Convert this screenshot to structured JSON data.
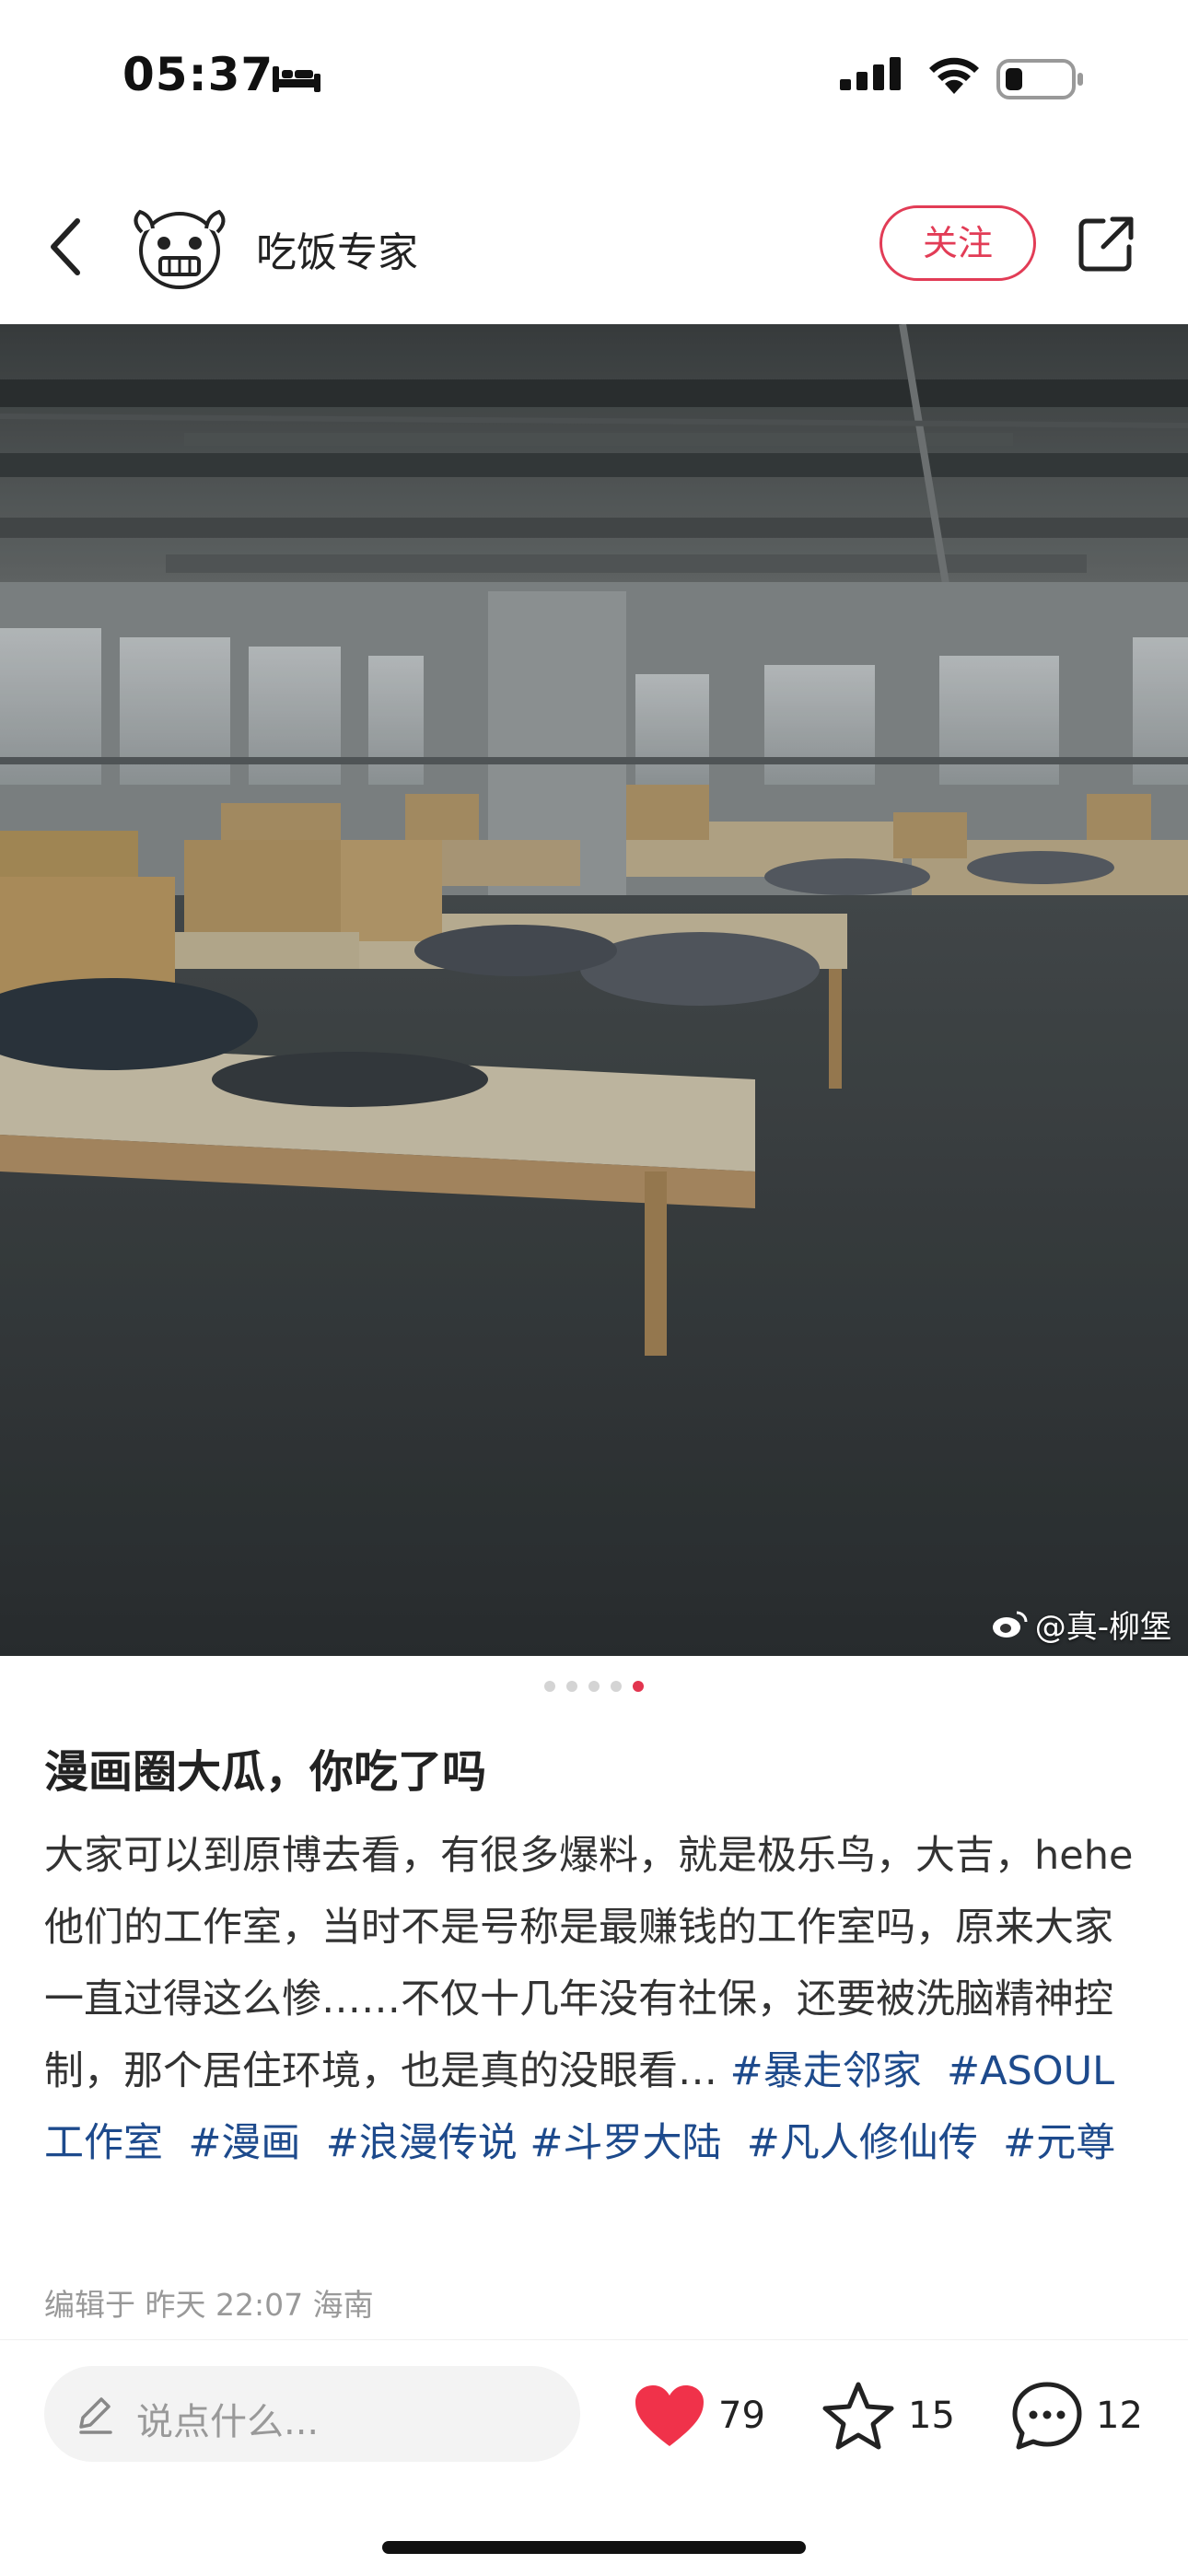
{
  "status_bar": {
    "time": "05:37"
  },
  "header": {
    "author_name": "吃饭专家",
    "follow_label": "关注"
  },
  "photo": {
    "watermark": "@真-柳堡",
    "page_count": 5,
    "active_page": 5
  },
  "post": {
    "title": "漫画圈大瓜，你吃了吗",
    "body": "大家可以到原博去看，有很多爆料，就是极乐鸟，大吉，hehe他们的工作室，当时不是号称是最赚钱的工作室吗，原来大家一直过得这么惨……不仅十几年没有社保，还要被洗脑精神控制，那个居住环境，也是真的没眼看… ",
    "tags": [
      "#暴走邻家",
      "#ASOUL 工作室",
      "#漫画",
      "#浪漫传说",
      "#斗罗大陆",
      "#凡人修仙传",
      "#元尊"
    ],
    "meta": "编辑于 昨天 22:07 海南"
  },
  "bottom_bar": {
    "comment_placeholder": "说点什么...",
    "like_count": "79",
    "collect_count": "15",
    "comment_count": "12"
  },
  "colors": {
    "accent": "#e23c56",
    "tag": "#1d4a8c",
    "like": "#f0324a"
  }
}
